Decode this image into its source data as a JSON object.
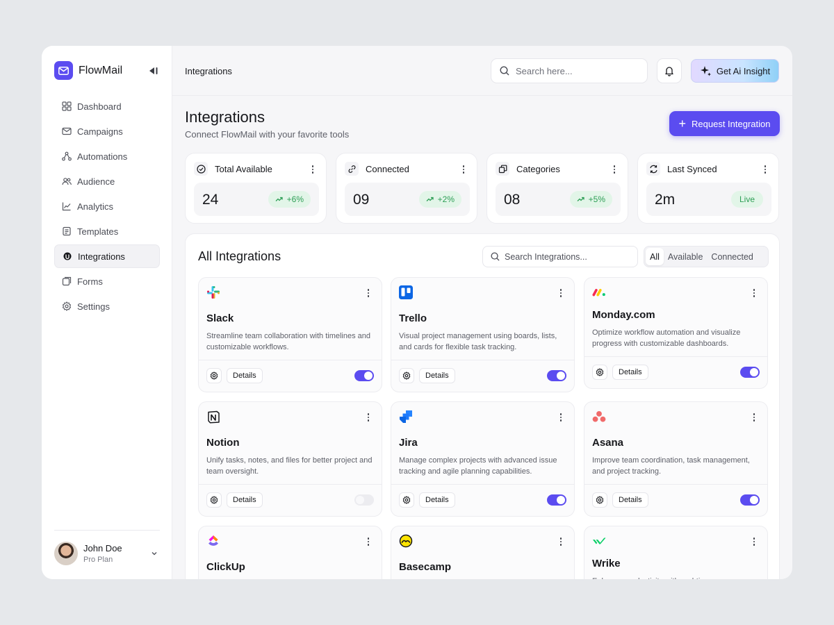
{
  "brand": {
    "name": "FlowMail"
  },
  "sidebar": {
    "items": [
      {
        "label": "Dashboard",
        "icon": "grid-icon"
      },
      {
        "label": "Campaigns",
        "icon": "mail-icon"
      },
      {
        "label": "Automations",
        "icon": "nodes-icon"
      },
      {
        "label": "Audience",
        "icon": "users-icon"
      },
      {
        "label": "Analytics",
        "icon": "chart-icon"
      },
      {
        "label": "Templates",
        "icon": "template-icon"
      },
      {
        "label": "Integrations",
        "icon": "integrations-icon",
        "active": true
      },
      {
        "label": "Forms",
        "icon": "forms-icon"
      },
      {
        "label": "Settings",
        "icon": "gear-icon"
      }
    ]
  },
  "user": {
    "name": "John Doe",
    "plan": "Pro Plan"
  },
  "topbar": {
    "breadcrumb": "Integrations",
    "search_placeholder": "Search here...",
    "ai_button": "Get Ai Insight"
  },
  "page": {
    "title": "Integrations",
    "subtitle": "Connect FlowMail with your favorite tools",
    "request_button": "Request Integration"
  },
  "stats": [
    {
      "label": "Total Available",
      "value": "24",
      "badge": "+6%",
      "icon": "check-circle-icon"
    },
    {
      "label": "Connected",
      "value": "09",
      "badge": "+2%",
      "icon": "link-icon"
    },
    {
      "label": "Categories",
      "value": "08",
      "badge": "+5%",
      "icon": "copy-icon"
    },
    {
      "label": "Last Synced",
      "value": "2m",
      "badge": "Live",
      "icon": "refresh-icon"
    }
  ],
  "panel": {
    "title": "All Integrations",
    "search_placeholder": "Search Integrations...",
    "filters": [
      "All",
      "Available",
      "Connected"
    ],
    "active_filter": "All"
  },
  "details_label": "Details",
  "integrations": [
    {
      "name": "Slack",
      "desc": "Streamline team collaboration with timelines and customizable workflows.",
      "enabled": true,
      "logo": "slack-logo"
    },
    {
      "name": "Trello",
      "desc": "Visual project management using boards, lists, and cards for flexible task tracking.",
      "enabled": true,
      "logo": "trello-logo"
    },
    {
      "name": "Monday.com",
      "desc": "Optimize workflow automation and visualize progress with customizable dashboards.",
      "enabled": true,
      "logo": "monday-logo"
    },
    {
      "name": "Notion",
      "desc": "Unify tasks, notes, and files for better project and team oversight.",
      "enabled": false,
      "logo": "notion-logo"
    },
    {
      "name": "Jira",
      "desc": "Manage complex projects with advanced issue tracking and agile planning capabilities.",
      "enabled": true,
      "logo": "jira-logo"
    },
    {
      "name": "Asana",
      "desc": "Improve team coordination, task management, and project tracking.",
      "enabled": true,
      "logo": "asana-logo"
    },
    {
      "name": "ClickUp",
      "desc": "",
      "enabled": true,
      "logo": "clickup-logo"
    },
    {
      "name": "Basecamp",
      "desc": "",
      "enabled": true,
      "logo": "basecamp-logo"
    },
    {
      "name": "Wrike",
      "desc": "Enhance productivity with real-time",
      "enabled": true,
      "logo": "wrike-logo"
    }
  ],
  "colors": {
    "accent": "#5b4cf0",
    "success": "#2d9e55",
    "success_bg": "#e2f5e8"
  }
}
